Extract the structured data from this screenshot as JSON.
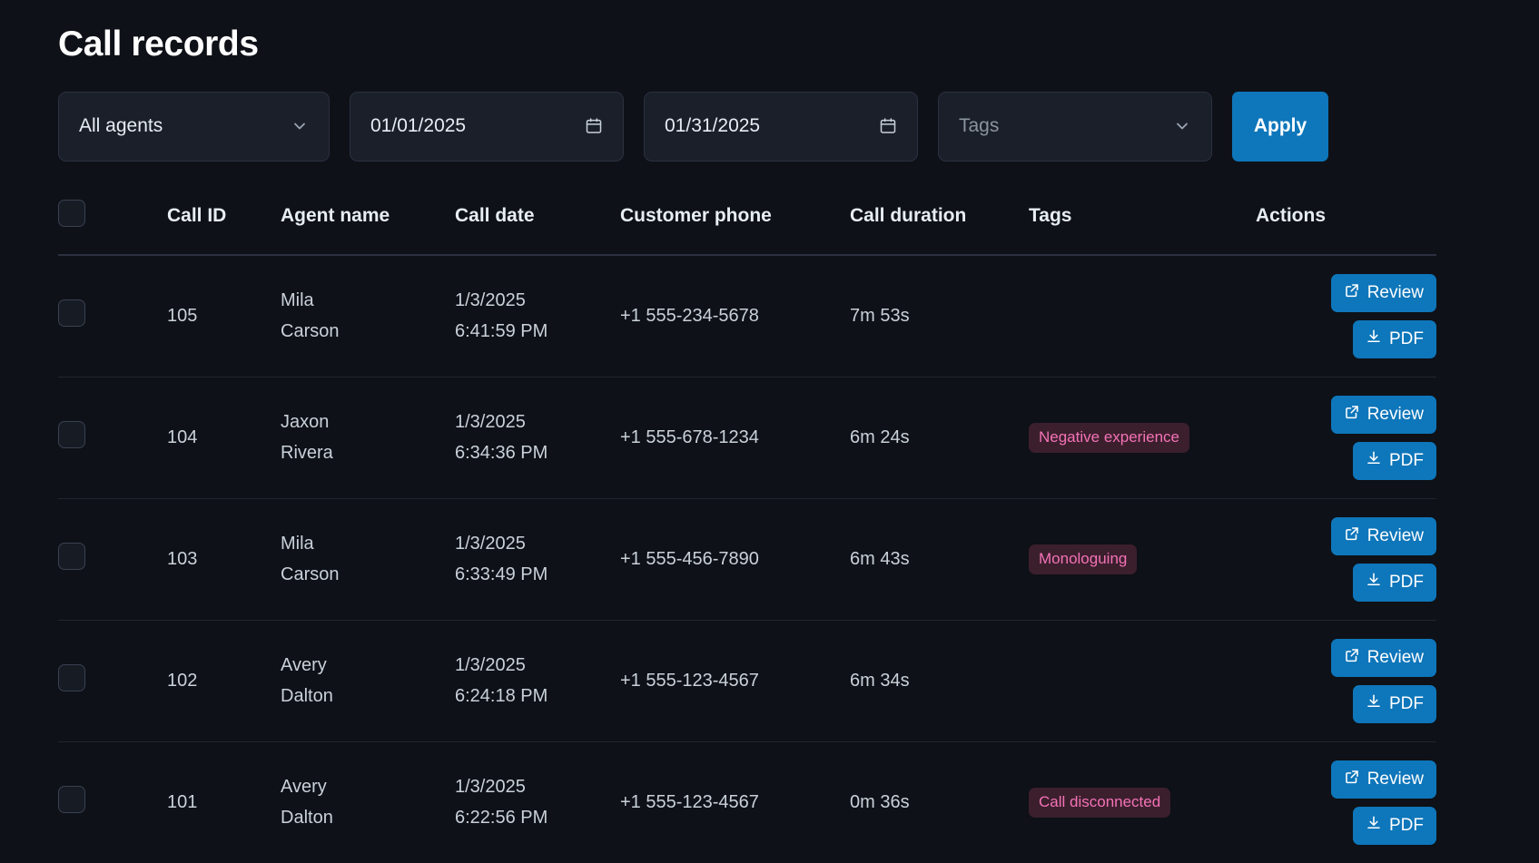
{
  "page": {
    "title": "Call records"
  },
  "filters": {
    "agent": {
      "value": "All agents",
      "icon": "chevron-down-icon"
    },
    "date_from": {
      "value": "01/01/2025",
      "icon": "calendar-icon"
    },
    "date_to": {
      "value": "01/31/2025",
      "icon": "calendar-icon"
    },
    "tags": {
      "placeholder": "Tags",
      "value": "Tags",
      "icon": "chevron-down-icon"
    },
    "apply_label": "Apply"
  },
  "table": {
    "columns": [
      "",
      "Call ID",
      "Agent name",
      "Call date",
      "Customer phone",
      "Call duration",
      "Tags",
      "Actions"
    ],
    "actions": {
      "review_label": "Review",
      "pdf_label": "PDF"
    },
    "rows": [
      {
        "call_id": "105",
        "agent_first": "Mila",
        "agent_last": "Carson",
        "date": "1/3/2025",
        "time": "6:41:59 PM",
        "phone": "+1 555-234-5678",
        "duration": "7m 53s",
        "tag": ""
      },
      {
        "call_id": "104",
        "agent_first": "Jaxon",
        "agent_last": "Rivera",
        "date": "1/3/2025",
        "time": "6:34:36 PM",
        "phone": "+1 555-678-1234",
        "duration": "6m 24s",
        "tag": "Negative experience"
      },
      {
        "call_id": "103",
        "agent_first": "Mila",
        "agent_last": "Carson",
        "date": "1/3/2025",
        "time": "6:33:49 PM",
        "phone": "+1 555-456-7890",
        "duration": "6m 43s",
        "tag": "Monologuing"
      },
      {
        "call_id": "102",
        "agent_first": "Avery",
        "agent_last": "Dalton",
        "date": "1/3/2025",
        "time": "6:24:18 PM",
        "phone": "+1 555-123-4567",
        "duration": "6m 34s",
        "tag": ""
      },
      {
        "call_id": "101",
        "agent_first": "Avery",
        "agent_last": "Dalton",
        "date": "1/3/2025",
        "time": "6:22:56 PM",
        "phone": "+1 555-123-4567",
        "duration": "0m 36s",
        "tag": "Call disconnected"
      }
    ]
  },
  "colors": {
    "background": "#0e1117",
    "accent": "#0e76ba",
    "tag_text": "#f472b6",
    "tag_bg": "#3b1f2d",
    "text_primary": "#e6edf3",
    "text_muted": "#8b949e"
  }
}
